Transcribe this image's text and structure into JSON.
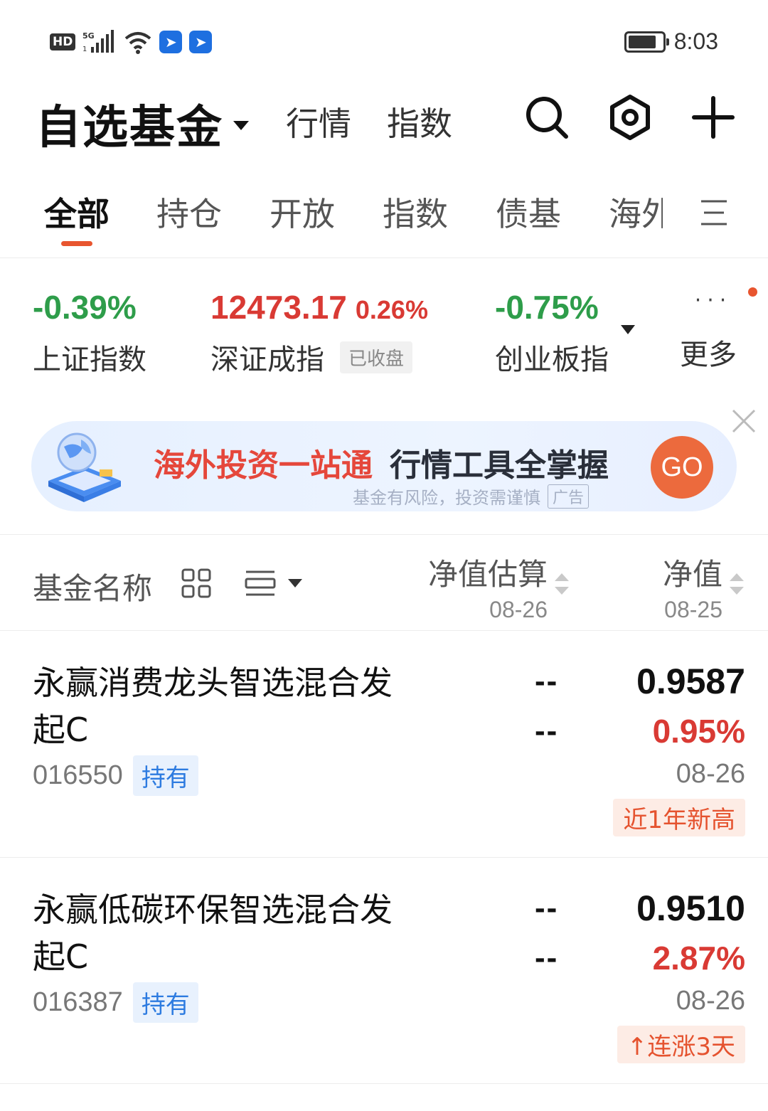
{
  "status_bar": {
    "hd": "HD",
    "time": "8:03",
    "icons": [
      "hd-icon",
      "signal-5g-icon",
      "wifi-icon",
      "app-notification-icon",
      "app-notification-icon",
      "battery-icon"
    ]
  },
  "header": {
    "title": "自选基金",
    "tabs": [
      "行情",
      "指数"
    ],
    "icons": [
      "search-icon",
      "settings-icon",
      "add-icon"
    ]
  },
  "category_tabs": {
    "items": [
      "全部",
      "持仓",
      "开放",
      "指数",
      "债基",
      "海外"
    ],
    "active": "全部",
    "menu_icon": "menu-icon"
  },
  "indices": [
    {
      "value": "-0.39%",
      "pct": "",
      "name": "上证指数",
      "color": "#2e9d4a"
    },
    {
      "value": "12473.17",
      "pct": "0.26%",
      "name": "深证成指",
      "badge": "已收盘",
      "color": "#d93a34"
    },
    {
      "value": "-0.75%",
      "pct": "",
      "name": "创业板指",
      "color": "#2e9d4a"
    }
  ],
  "more": {
    "dots": "···",
    "label": "更多"
  },
  "banner": {
    "headline_red": "海外投资一站通",
    "headline_dark": "行情工具全掌握",
    "note": "基金有风险，投资需谨慎",
    "ad_tag": "广告",
    "button": "GO"
  },
  "list_header": {
    "name_col": "基金名称",
    "est_col": {
      "title": "净值估算",
      "date": "08-26"
    },
    "nav_col": {
      "title": "净值",
      "date": "08-25"
    }
  },
  "funds": [
    {
      "name": "永赢消费龙头智选混合发起C",
      "code": "016550",
      "tag": "持有",
      "est_value": "--",
      "est_change": "--",
      "nav": "0.9587",
      "change": "0.95%",
      "date": "08-26",
      "badge": "近1年新高"
    },
    {
      "name": "永赢低碳环保智选混合发起C",
      "code": "016387",
      "tag": "持有",
      "est_value": "--",
      "est_change": "--",
      "nav": "0.9510",
      "change": "2.87%",
      "date": "08-26",
      "badge": "连涨3天",
      "badge_icon": "arrow-up-icon"
    }
  ],
  "colors": {
    "accent": "#e8552f",
    "up": "#d93a34",
    "down": "#2e9d4a",
    "tag_blue": "#2d7be0"
  }
}
